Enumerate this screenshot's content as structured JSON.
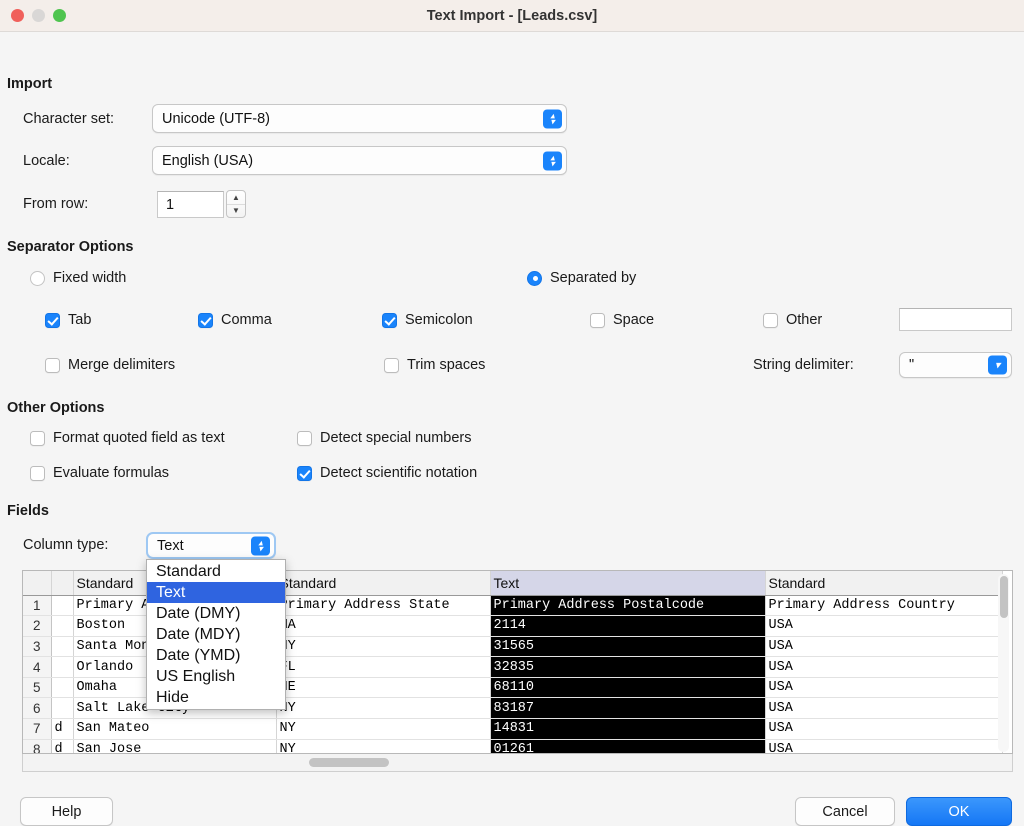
{
  "window": {
    "title": "Text Import - [Leads.csv]",
    "traffic_lights": [
      "close-button",
      "minimize-button",
      "maximize-button"
    ]
  },
  "import_section": {
    "heading": "Import",
    "character_set": {
      "label": "Character set:",
      "value": "Unicode (UTF-8)"
    },
    "locale": {
      "label": "Locale:",
      "value": "English (USA)"
    },
    "from_row": {
      "label": "From row:",
      "value": "1"
    }
  },
  "separator_section": {
    "heading": "Separator Options",
    "fixed_width": {
      "label": "Fixed width",
      "checked": false
    },
    "separated_by": {
      "label": "Separated by",
      "checked": true
    },
    "tab": {
      "label": "Tab",
      "checked": true
    },
    "comma": {
      "label": "Comma",
      "checked": true
    },
    "semicolon": {
      "label": "Semicolon",
      "checked": true
    },
    "space": {
      "label": "Space",
      "checked": false
    },
    "other": {
      "label": "Other",
      "checked": false,
      "value": ""
    },
    "merge_delimiters": {
      "label": "Merge delimiters",
      "checked": false
    },
    "trim_spaces": {
      "label": "Trim spaces",
      "checked": false
    },
    "string_delimiter": {
      "label": "String delimiter:",
      "value": "\""
    }
  },
  "other_options_section": {
    "heading": "Other Options",
    "format_quoted": {
      "label": "Format quoted field as text",
      "checked": false
    },
    "detect_special": {
      "label": "Detect special numbers",
      "checked": false
    },
    "evaluate_formulas": {
      "label": "Evaluate formulas",
      "checked": false
    },
    "detect_scientific": {
      "label": "Detect scientific notation",
      "checked": true
    }
  },
  "fields_section": {
    "heading": "Fields",
    "column_type": {
      "label": "Column type:",
      "value": "Text"
    },
    "column_type_options": [
      "Standard",
      "Text",
      "Date (DMY)",
      "Date (MDY)",
      "Date (YMD)",
      "US English",
      "Hide"
    ],
    "column_type_selected": "Text"
  },
  "preview": {
    "column_types": [
      "",
      "",
      "Standard",
      "Standard",
      "Text",
      "Standard"
    ],
    "selected_column_index": 4,
    "rows": [
      {
        "num": "1",
        "tiny": "",
        "a": "Primary Address City",
        "b": "Primary Address State",
        "c": "Primary Address Postalcode",
        "d": "Primary Address Country"
      },
      {
        "num": "2",
        "tiny": "",
        "a": "Boston",
        "b": "MA",
        "c": "2114",
        "d": "USA"
      },
      {
        "num": "3",
        "tiny": "",
        "a": "Santa Monica",
        "b": "NY",
        "c": "31565",
        "d": "USA"
      },
      {
        "num": "4",
        "tiny": "",
        "a": "Orlando",
        "b": "FL",
        "c": "32835",
        "d": "USA"
      },
      {
        "num": "5",
        "tiny": "",
        "a": "Omaha",
        "b": "NE",
        "c": "68110",
        "d": "USA"
      },
      {
        "num": "6",
        "tiny": "",
        "a": "Salt Lake City",
        "b": "NY",
        "c": "83187",
        "d": "USA"
      },
      {
        "num": "7",
        "tiny": "d",
        "a": "San Mateo",
        "b": "NY",
        "c": "14831",
        "d": "USA"
      },
      {
        "num": "8",
        "tiny": "d",
        "a": "San Jose",
        "b": "NY",
        "c": "01261",
        "d": "USA"
      }
    ]
  },
  "buttons": {
    "help": "Help",
    "cancel": "Cancel",
    "ok": "OK"
  },
  "colors": {
    "accent": "#1a84fb",
    "menu_highlight": "#2f64e0",
    "selected_header": "#d5d6e8",
    "selected_cell": "#000000"
  }
}
